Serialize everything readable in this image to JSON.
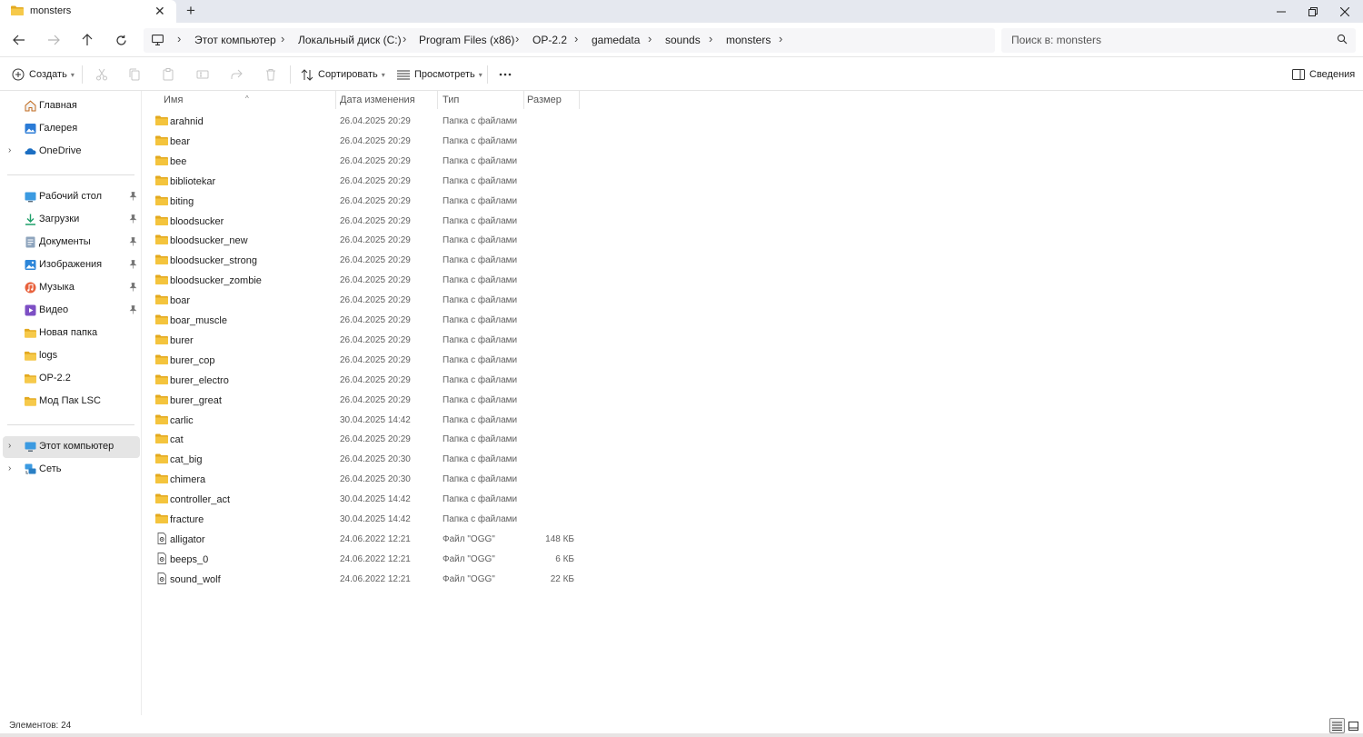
{
  "tab": {
    "title": "monsters",
    "close": "✕",
    "new_tab": "+"
  },
  "window": {
    "minimize": "—",
    "maximize": "▢",
    "close": "✕"
  },
  "breadcrumb": [
    "Этот компьютер",
    "Локальный диск (C:)",
    "Program Files (x86)",
    "OP-2.2",
    "gamedata",
    "sounds",
    "monsters"
  ],
  "breadcrumb_separator": "›",
  "search": {
    "placeholder": "Поиск в: monsters"
  },
  "commands": {
    "create": "Создать",
    "sort": "Сортировать",
    "view": "Просмотреть",
    "details": "Сведения"
  },
  "sidebar": {
    "top": [
      {
        "label": "Главная",
        "icon": "home-icon"
      },
      {
        "label": "Галерея",
        "icon": "gallery-icon"
      },
      {
        "label": "OneDrive",
        "icon": "onedrive-icon"
      }
    ],
    "quick_access": [
      {
        "label": "Рабочий стол",
        "icon": "desktop-icon",
        "pinned": true
      },
      {
        "label": "Загрузки",
        "icon": "downloads-icon",
        "pinned": true
      },
      {
        "label": "Документы",
        "icon": "documents-icon",
        "pinned": true
      },
      {
        "label": "Изображения",
        "icon": "pictures-icon",
        "pinned": true
      },
      {
        "label": "Музыка",
        "icon": "music-icon",
        "pinned": true
      },
      {
        "label": "Видео",
        "icon": "video-icon",
        "pinned": true
      },
      {
        "label": "Новая папка",
        "icon": "folder-icon",
        "pinned": false
      },
      {
        "label": "logs",
        "icon": "folder-icon",
        "pinned": false
      },
      {
        "label": "OP-2.2",
        "icon": "folder-icon",
        "pinned": false
      },
      {
        "label": "Мод Пак LSC",
        "icon": "folder-icon",
        "pinned": false
      }
    ],
    "devices": [
      {
        "label": "Этот компьютер",
        "icon": "computer-icon",
        "selected": true
      },
      {
        "label": "Сеть",
        "icon": "network-icon",
        "selected": false
      }
    ]
  },
  "columns": {
    "name": "Имя",
    "date": "Дата изменения",
    "type": "Тип",
    "size": "Размер"
  },
  "files": [
    {
      "name": "arahnid",
      "date": "26.04.2025 20:29",
      "type": "Папка с файлами",
      "size": "",
      "kind": "folder"
    },
    {
      "name": "bear",
      "date": "26.04.2025 20:29",
      "type": "Папка с файлами",
      "size": "",
      "kind": "folder"
    },
    {
      "name": "bee",
      "date": "26.04.2025 20:29",
      "type": "Папка с файлами",
      "size": "",
      "kind": "folder"
    },
    {
      "name": "bibliotekar",
      "date": "26.04.2025 20:29",
      "type": "Папка с файлами",
      "size": "",
      "kind": "folder"
    },
    {
      "name": "biting",
      "date": "26.04.2025 20:29",
      "type": "Папка с файлами",
      "size": "",
      "kind": "folder"
    },
    {
      "name": "bloodsucker",
      "date": "26.04.2025 20:29",
      "type": "Папка с файлами",
      "size": "",
      "kind": "folder"
    },
    {
      "name": "bloodsucker_new",
      "date": "26.04.2025 20:29",
      "type": "Папка с файлами",
      "size": "",
      "kind": "folder"
    },
    {
      "name": "bloodsucker_strong",
      "date": "26.04.2025 20:29",
      "type": "Папка с файлами",
      "size": "",
      "kind": "folder"
    },
    {
      "name": "bloodsucker_zombie",
      "date": "26.04.2025 20:29",
      "type": "Папка с файлами",
      "size": "",
      "kind": "folder"
    },
    {
      "name": "boar",
      "date": "26.04.2025 20:29",
      "type": "Папка с файлами",
      "size": "",
      "kind": "folder"
    },
    {
      "name": "boar_muscle",
      "date": "26.04.2025 20:29",
      "type": "Папка с файлами",
      "size": "",
      "kind": "folder"
    },
    {
      "name": "burer",
      "date": "26.04.2025 20:29",
      "type": "Папка с файлами",
      "size": "",
      "kind": "folder"
    },
    {
      "name": "burer_cop",
      "date": "26.04.2025 20:29",
      "type": "Папка с файлами",
      "size": "",
      "kind": "folder"
    },
    {
      "name": "burer_electro",
      "date": "26.04.2025 20:29",
      "type": "Папка с файлами",
      "size": "",
      "kind": "folder"
    },
    {
      "name": "burer_great",
      "date": "26.04.2025 20:29",
      "type": "Папка с файлами",
      "size": "",
      "kind": "folder"
    },
    {
      "name": "carlic",
      "date": "30.04.2025 14:42",
      "type": "Папка с файлами",
      "size": "",
      "kind": "folder"
    },
    {
      "name": "cat",
      "date": "26.04.2025 20:29",
      "type": "Папка с файлами",
      "size": "",
      "kind": "folder"
    },
    {
      "name": "cat_big",
      "date": "26.04.2025 20:30",
      "type": "Папка с файлами",
      "size": "",
      "kind": "folder"
    },
    {
      "name": "chimera",
      "date": "26.04.2025 20:30",
      "type": "Папка с файлами",
      "size": "",
      "kind": "folder"
    },
    {
      "name": "controller_act",
      "date": "30.04.2025 14:42",
      "type": "Папка с файлами",
      "size": "",
      "kind": "folder"
    },
    {
      "name": "fracture",
      "date": "30.04.2025 14:42",
      "type": "Папка с файлами",
      "size": "",
      "kind": "folder"
    },
    {
      "name": "alligator",
      "date": "24.06.2022 12:21",
      "type": "Файл \"OGG\"",
      "size": "148 КБ",
      "kind": "file"
    },
    {
      "name": "beeps_0",
      "date": "24.06.2022 12:21",
      "type": "Файл \"OGG\"",
      "size": "6 КБ",
      "kind": "file"
    },
    {
      "name": "sound_wolf",
      "date": "24.06.2022 12:21",
      "type": "Файл \"OGG\"",
      "size": "22 КБ",
      "kind": "file"
    }
  ],
  "status": {
    "items_count": "Элементов: 24"
  },
  "colors": {
    "folder": "#f4c43d",
    "folder_dark": "#e3a91f",
    "selected": "#e5e5e5",
    "onedrive": "#1b6ec2",
    "accent": "#0067c0"
  }
}
